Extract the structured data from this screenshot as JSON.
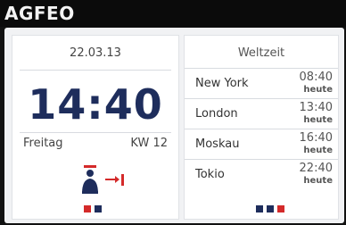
{
  "brand": "AGFEO",
  "clock": {
    "date": "22.03.13",
    "time": "14:40",
    "weekday": "Freitag",
    "calendar_week": "KW 12"
  },
  "world_time": {
    "title": "Weltzeit",
    "entries": [
      {
        "city": "New York",
        "time": "08:40",
        "day": "heute"
      },
      {
        "city": "London",
        "time": "13:40",
        "day": "heute"
      },
      {
        "city": "Moskau",
        "time": "16:40",
        "day": "heute"
      },
      {
        "city": "Tokio",
        "time": "22:40",
        "day": "heute"
      }
    ]
  },
  "page_indicators": {
    "left": [
      "#d42a2a",
      "#1e2d5c"
    ],
    "right": [
      "#1e2d5c",
      "#1e2d5c",
      "#d42a2a"
    ]
  },
  "icons": {
    "status_person": "user-status-icon",
    "forward": "call-forward-icon"
  },
  "colors": {
    "accent_navy": "#1e2d5c",
    "accent_red": "#d42a2a"
  }
}
